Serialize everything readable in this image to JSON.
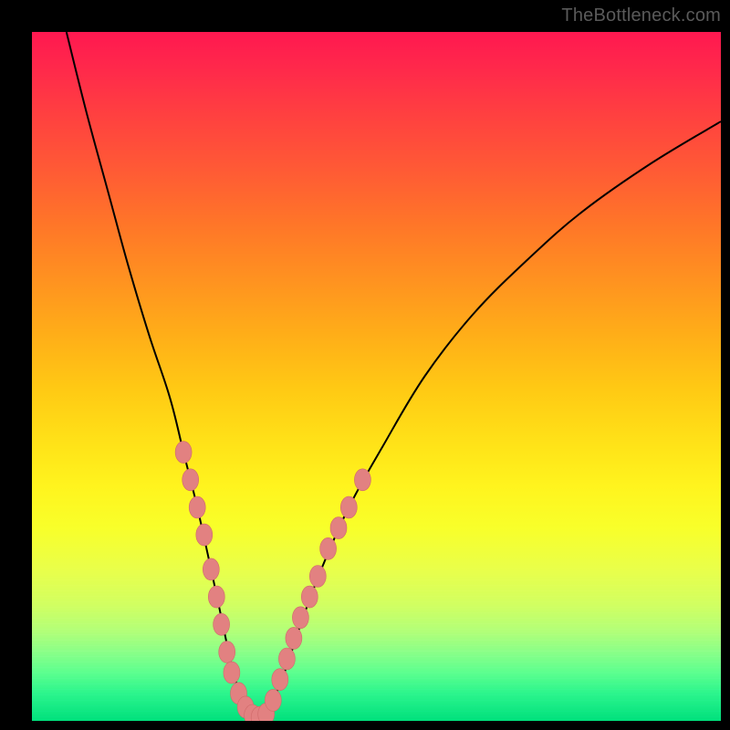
{
  "watermark": "TheBottleneck.com",
  "chart_data": {
    "type": "line",
    "title": "",
    "xlabel": "",
    "ylabel": "",
    "xlim": [
      0,
      100
    ],
    "ylim": [
      0,
      100
    ],
    "grid": false,
    "legend": false,
    "background": "rainbow-vertical",
    "series": [
      {
        "name": "bottleneck-curve",
        "x": [
          5,
          8,
          11,
          14,
          17,
          20,
          22,
          24,
          26,
          27.5,
          29,
          30.5,
          32,
          33.5,
          35,
          37,
          39,
          42,
          46,
          51,
          57,
          64,
          72,
          80,
          90,
          100
        ],
        "y": [
          100,
          88,
          77,
          66,
          56,
          47,
          39,
          31,
          22,
          15,
          8,
          3,
          0.5,
          0.5,
          3,
          8,
          14,
          22,
          31,
          40,
          50,
          59,
          67,
          74,
          81,
          87
        ]
      }
    ],
    "markers": {
      "name": "salmon-dots",
      "color": "#e28181",
      "points": [
        {
          "x": 22.0,
          "y": 39
        },
        {
          "x": 23.0,
          "y": 35
        },
        {
          "x": 24.0,
          "y": 31
        },
        {
          "x": 25.0,
          "y": 27
        },
        {
          "x": 26.0,
          "y": 22
        },
        {
          "x": 26.8,
          "y": 18
        },
        {
          "x": 27.5,
          "y": 14
        },
        {
          "x": 28.3,
          "y": 10
        },
        {
          "x": 29.0,
          "y": 7
        },
        {
          "x": 30.0,
          "y": 4
        },
        {
          "x": 31.0,
          "y": 2
        },
        {
          "x": 32.0,
          "y": 0.8
        },
        {
          "x": 33.0,
          "y": 0.5
        },
        {
          "x": 34.0,
          "y": 1
        },
        {
          "x": 35.0,
          "y": 3
        },
        {
          "x": 36.0,
          "y": 6
        },
        {
          "x": 37.0,
          "y": 9
        },
        {
          "x": 38.0,
          "y": 12
        },
        {
          "x": 39.0,
          "y": 15
        },
        {
          "x": 40.3,
          "y": 18
        },
        {
          "x": 41.5,
          "y": 21
        },
        {
          "x": 43.0,
          "y": 25
        },
        {
          "x": 44.5,
          "y": 28
        },
        {
          "x": 46.0,
          "y": 31
        },
        {
          "x": 48.0,
          "y": 35
        }
      ]
    }
  }
}
